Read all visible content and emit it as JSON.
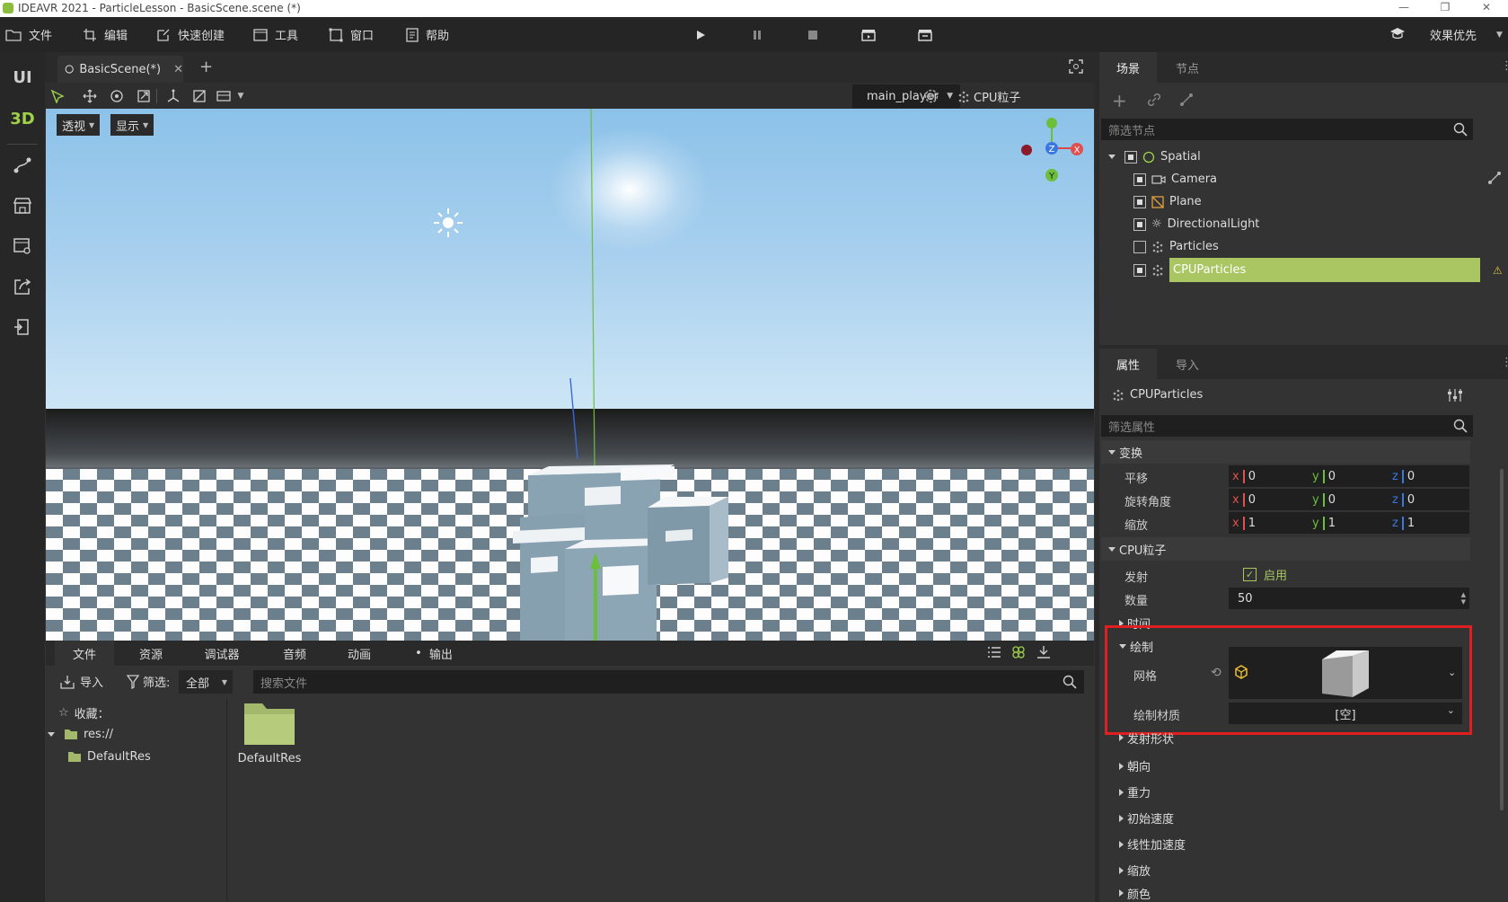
{
  "window": {
    "title": "IDEAVR 2021 - ParticleLesson - BasicScene.scene (*)"
  },
  "menu": {
    "items": [
      "文件",
      "编辑",
      "快速创建",
      "工具",
      "窗口",
      "帮助"
    ],
    "quality_label": "效果优先"
  },
  "left_strip": {
    "ui_label": "UI",
    "3d_label": "3D"
  },
  "scene_tab": {
    "label": "BasicScene(*)"
  },
  "viewport_toolbar": {
    "player": "main_player",
    "particles_label": "CPU粒子"
  },
  "viewport": {
    "perspective_label": "透视",
    "display_label": "显示",
    "gizmo_axes": [
      "Z",
      "Y",
      "X"
    ]
  },
  "bottom_tabs": [
    "文件",
    "资源",
    "调试器",
    "音频",
    "动画",
    "输出"
  ],
  "filesystem": {
    "import_label": "导入",
    "filter_label": "筛选:",
    "filter_value": "全部",
    "search_placeholder": "搜索文件",
    "favorites_label": "收藏：",
    "root": "res://",
    "folder": "DefaultRes",
    "file_item": "DefaultRes"
  },
  "scene_panel": {
    "tabs": [
      "场景",
      "节点"
    ],
    "filter_placeholder": "筛选节点",
    "nodes": [
      {
        "name": "Spatial",
        "checked": true
      },
      {
        "name": "Camera",
        "checked": true
      },
      {
        "name": "Plane",
        "checked": true
      },
      {
        "name": "DirectionalLight",
        "checked": true
      },
      {
        "name": "Particles",
        "checked": false
      },
      {
        "name": "CPUParticles",
        "checked": true,
        "selected": true
      }
    ]
  },
  "inspector": {
    "tabs": [
      "属性",
      "导入"
    ],
    "object_name": "CPUParticles",
    "filter_placeholder": "筛选属性",
    "transform": {
      "header": "变换",
      "rows": [
        {
          "label": "平移",
          "x": "0",
          "y": "0",
          "z": "0"
        },
        {
          "label": "旋转角度",
          "x": "0",
          "y": "0",
          "z": "0"
        },
        {
          "label": "缩放",
          "x": "1",
          "y": "1",
          "z": "1"
        }
      ]
    },
    "cpu_particles": {
      "header": "CPU粒子",
      "emit_label": "发射",
      "emit_value": "启用",
      "amount_label": "数量",
      "amount_value": "50",
      "time_label": "时间"
    },
    "drawing": {
      "header": "绘制",
      "mesh_label": "网格",
      "material_label": "绘制材质",
      "material_value": "[空]"
    },
    "collapsed_sections": [
      "发射形状",
      "朝向",
      "重力",
      "初始速度",
      "线性加速度",
      "缩放",
      "颜色"
    ]
  },
  "colors": {
    "selection": "#a9c663",
    "highlight_border": "#e02020",
    "accent_green": "#8bbd3c"
  }
}
